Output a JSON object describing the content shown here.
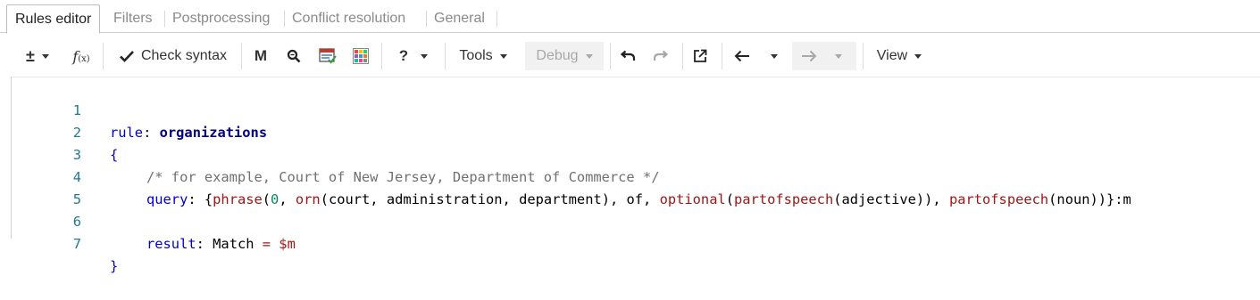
{
  "tabs": [
    {
      "label": "Rules editor",
      "active": true
    },
    {
      "label": "Filters"
    },
    {
      "label": "Postprocessing"
    },
    {
      "label": "Conflict resolution"
    },
    {
      "label": "General"
    }
  ],
  "toolbar": {
    "check_syntax": "Check syntax",
    "m_label": "M",
    "help_label": "?",
    "tools": "Tools",
    "debug": "Debug",
    "view": "View",
    "icons": [
      "plus-minus-icon",
      "function-icon",
      "checkmark-icon",
      "zoom-icon",
      "calendar-icon",
      "grid-color-icon",
      "undo-icon",
      "redo-icon",
      "external-link-icon",
      "arrow-left-icon",
      "arrow-right-icon"
    ]
  },
  "editor": {
    "line_numbers": [
      "1",
      "2",
      "3",
      "4",
      "5",
      "6",
      "7"
    ],
    "line1": {
      "kw": "rule",
      "sep": ": ",
      "name": "organizations"
    },
    "line2": "{",
    "line3": "/* for example, Court of New Jersey, Department of Commerce */",
    "line4": {
      "kw": "query",
      "t1": ": {",
      "f1": "phrase",
      "t2": "(",
      "n1": "0",
      "t3": ", ",
      "f2": "orn",
      "t4": "(court, administration, department), of, ",
      "f3": "optional",
      "t5": "(",
      "f4": "partofspeech",
      "t6": "(adjective)), ",
      "f5": "partofspeech",
      "t7": "(noun))}:m"
    },
    "line6": {
      "kw": "result",
      "t1": ": ",
      "name": "Match",
      "t2": " = $m"
    },
    "line7": "}"
  },
  "colors": {
    "keyword": "#0000cc",
    "comment": "#707070",
    "function": "#a31515",
    "line_number": "#237893"
  }
}
